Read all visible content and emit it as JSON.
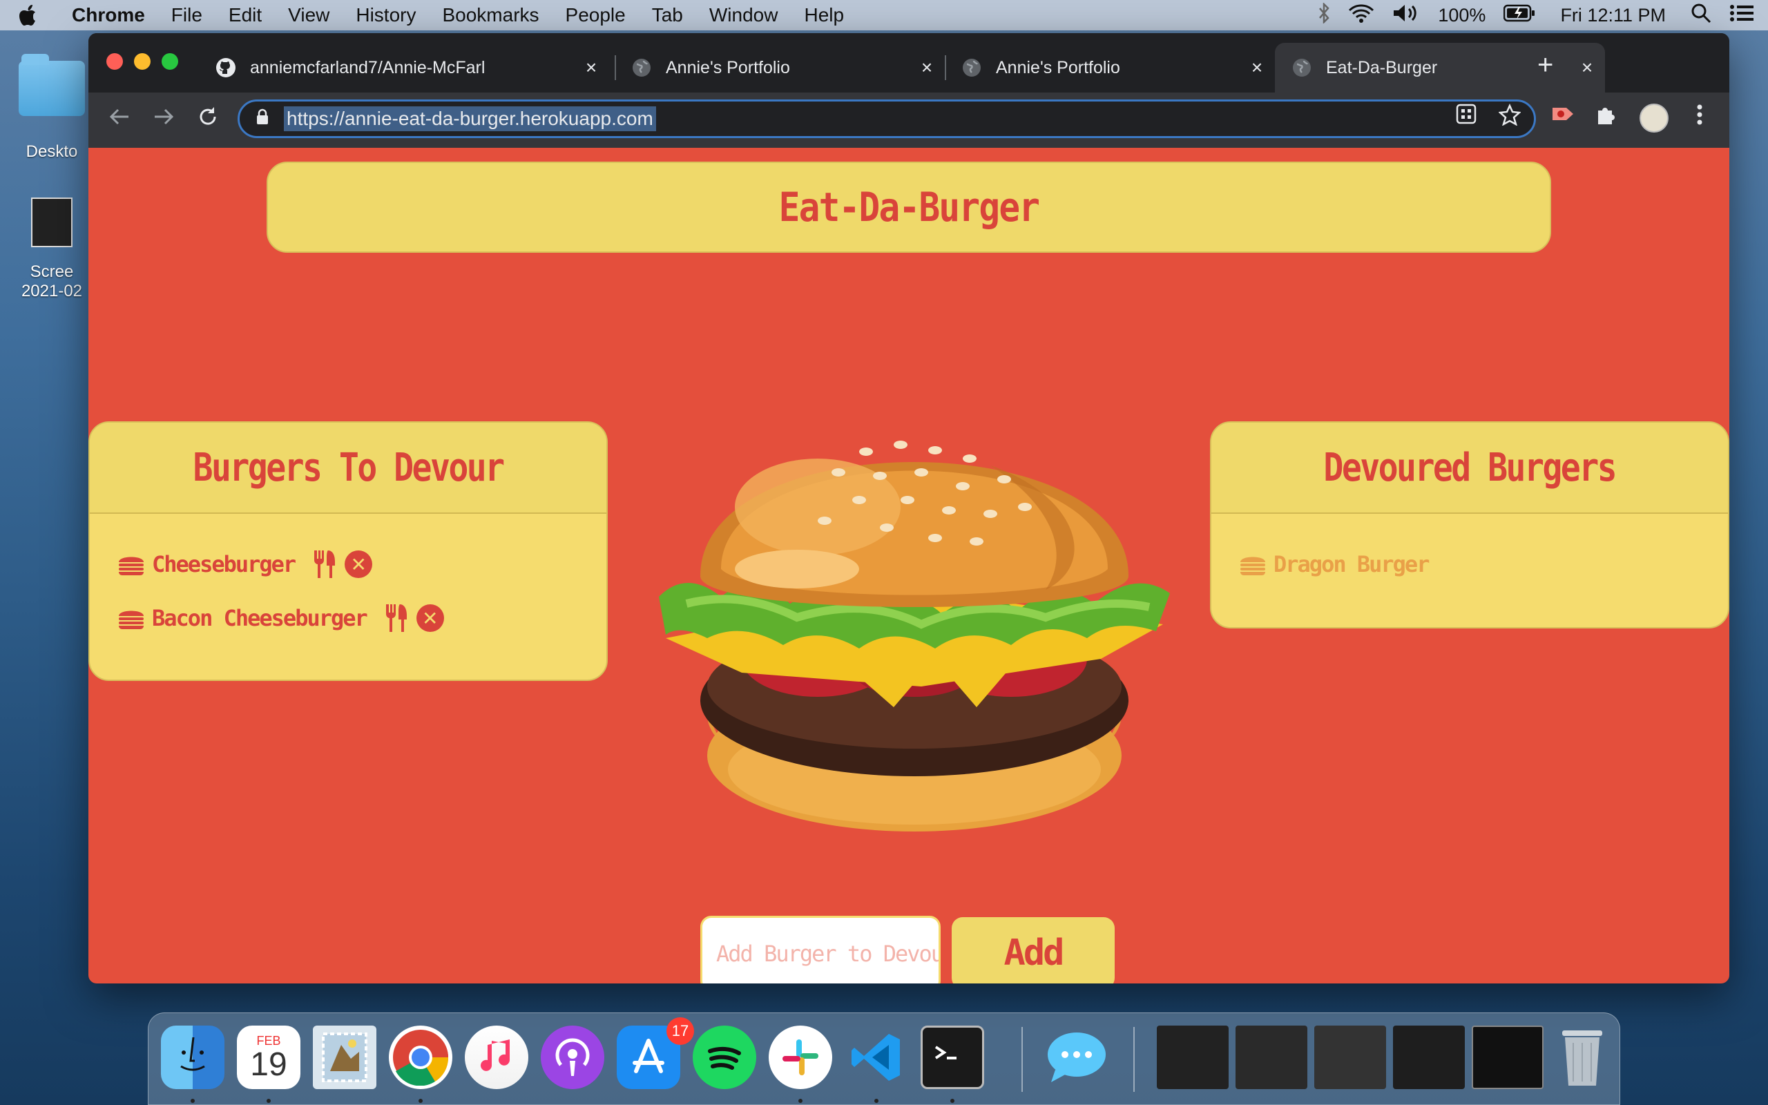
{
  "menubar": {
    "app_name": "Chrome",
    "items": [
      "File",
      "Edit",
      "View",
      "History",
      "Bookmarks",
      "People",
      "Tab",
      "Window",
      "Help"
    ],
    "battery": "100%",
    "clock": "Fri 12:11 PM"
  },
  "desktop": {
    "folder_label": "Deskto",
    "screenshot_label_1": "Scree",
    "screenshot_label_2": "2021-02"
  },
  "browser": {
    "tabs": [
      {
        "title": "anniemcfarland7/Annie-McFarl",
        "icon": "github-icon"
      },
      {
        "title": "Annie's Portfolio",
        "icon": "globe-icon"
      },
      {
        "title": "Annie's Portfolio",
        "icon": "globe-icon"
      },
      {
        "title": "Eat-Da-Burger",
        "icon": "globe-icon",
        "active": true
      }
    ],
    "url": "https://annie-eat-da-burger.herokuapp.com"
  },
  "page": {
    "title": "Eat-Da-Burger",
    "to_devour": {
      "heading": "Burgers To Devour",
      "items": [
        "Cheeseburger",
        "Bacon Cheeseburger"
      ]
    },
    "devoured": {
      "heading": "Devoured Burgers",
      "items": [
        "Dragon Burger"
      ]
    },
    "form": {
      "placeholder": "Add Burger to Devour",
      "button": "Add"
    }
  },
  "dock": {
    "calendar_month": "FEB",
    "calendar_day": "19",
    "appstore_badge": "17"
  },
  "colors": {
    "page_bg": "#e44f3c",
    "panel": "#efd96a",
    "accent_text": "#d9443a",
    "devoured_text": "#e9a048"
  }
}
